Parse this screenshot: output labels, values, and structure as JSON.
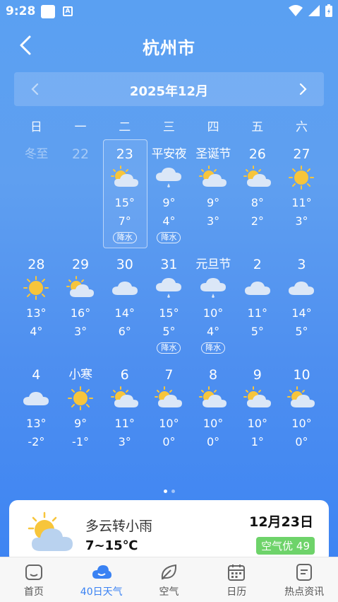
{
  "status_bar": {
    "time": "9:28",
    "a_icon_letter": "A"
  },
  "header": {
    "city": "杭州市"
  },
  "month_nav": {
    "label": "2025年12月"
  },
  "weekdays": [
    "日",
    "一",
    "二",
    "三",
    "四",
    "五",
    "六"
  ],
  "weeks": [
    [
      {
        "day": "冬至",
        "dim": true
      },
      {
        "day": "22",
        "dim": true
      },
      {
        "day": "23",
        "icon": "sun-cloud",
        "hi": "15°",
        "lo": "7°",
        "tag": "降水",
        "selected": true
      },
      {
        "day": "平安夜",
        "icon": "rain-cloud",
        "hi": "9°",
        "lo": "4°",
        "tag": "降水"
      },
      {
        "day": "圣诞节",
        "icon": "sun-cloud",
        "hi": "9°",
        "lo": "3°"
      },
      {
        "day": "26",
        "icon": "sun-cloud",
        "hi": "8°",
        "lo": "2°"
      },
      {
        "day": "27",
        "icon": "sun",
        "hi": "11°",
        "lo": "3°"
      }
    ],
    [
      {
        "day": "28",
        "icon": "sun",
        "hi": "13°",
        "lo": "4°"
      },
      {
        "day": "29",
        "icon": "sun-cloud",
        "hi": "16°",
        "lo": "3°"
      },
      {
        "day": "30",
        "icon": "cloud",
        "hi": "14°",
        "lo": "6°"
      },
      {
        "day": "31",
        "icon": "rain-cloud",
        "hi": "15°",
        "lo": "5°",
        "tag": "降水"
      },
      {
        "day": "元旦节",
        "icon": "rain-cloud",
        "hi": "10°",
        "lo": "4°",
        "tag": "降水"
      },
      {
        "day": "2",
        "icon": "cloud",
        "hi": "11°",
        "lo": "5°"
      },
      {
        "day": "3",
        "icon": "cloud",
        "hi": "14°",
        "lo": "5°"
      }
    ],
    [
      {
        "day": "4",
        "icon": "cloud",
        "hi": "13°",
        "lo": "-2°"
      },
      {
        "day": "小寒",
        "icon": "sun",
        "hi": "9°",
        "lo": "-1°"
      },
      {
        "day": "6",
        "icon": "sun-cloud",
        "hi": "11°",
        "lo": "3°"
      },
      {
        "day": "7",
        "icon": "sun-cloud",
        "hi": "10°",
        "lo": "0°"
      },
      {
        "day": "8",
        "icon": "sun-cloud",
        "hi": "10°",
        "lo": "0°"
      },
      {
        "day": "9",
        "icon": "sun-cloud",
        "hi": "10°",
        "lo": "1°"
      },
      {
        "day": "10",
        "icon": "sun-cloud",
        "hi": "10°",
        "lo": "0°"
      }
    ]
  ],
  "summary_card": {
    "condition": "多云转小雨",
    "temp_range": "7~15℃",
    "date": "12月23日",
    "aqi": "空气优 49",
    "icon": "sun-cloud"
  },
  "tabs": [
    {
      "label": "首页",
      "icon": "home-icon"
    },
    {
      "label": "40日天气",
      "icon": "cloud-icon",
      "active": true
    },
    {
      "label": "空气",
      "icon": "leaf-icon"
    },
    {
      "label": "日历",
      "icon": "calendar-icon"
    },
    {
      "label": "热点资讯",
      "icon": "news-icon"
    }
  ],
  "colors": {
    "accent": "#3a82f3",
    "aqi_good": "#6ed36a",
    "sun": "#f7c53b"
  }
}
